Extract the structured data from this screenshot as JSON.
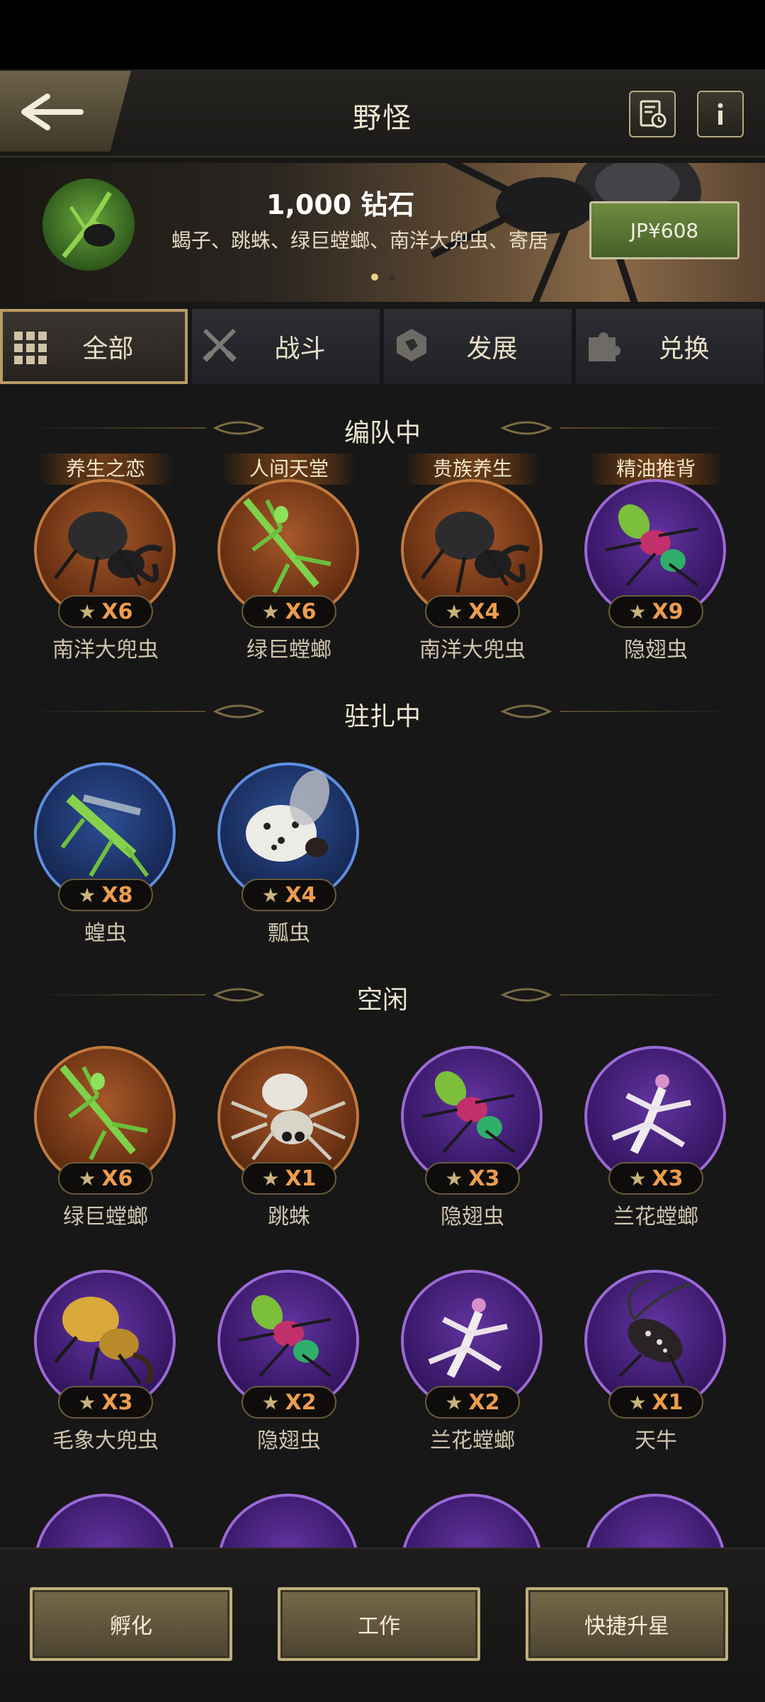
{
  "header": {
    "title": "野怪"
  },
  "banner": {
    "title": "1,000 钻石",
    "description": "蝎子、跳蛛、绿巨螳螂、南洋大兜虫、寄居",
    "price": "JP¥608"
  },
  "tabs": [
    {
      "label": "全部",
      "active": true
    },
    {
      "label": "战斗",
      "active": false
    },
    {
      "label": "发展",
      "active": false
    },
    {
      "label": "兑换",
      "active": false
    }
  ],
  "sections": {
    "formation": {
      "title": "编队中",
      "items": [
        {
          "tag": "养生之恋",
          "stars": "X6",
          "name": "南洋大兜虫",
          "rarity": "orange"
        },
        {
          "tag": "人间天堂",
          "stars": "X6",
          "name": "绿巨螳螂",
          "rarity": "orange"
        },
        {
          "tag": "贵族养生",
          "stars": "X4",
          "name": "南洋大兜虫",
          "rarity": "orange"
        },
        {
          "tag": "精油推背",
          "stars": "X9",
          "name": "隐翅虫",
          "rarity": "purple"
        }
      ]
    },
    "stationed": {
      "title": "驻扎中",
      "items": [
        {
          "stars": "X8",
          "name": "蝗虫",
          "rarity": "blue"
        },
        {
          "stars": "X4",
          "name": "瓢虫",
          "rarity": "blue"
        }
      ]
    },
    "idle": {
      "title": "空闲",
      "items": [
        {
          "stars": "X6",
          "name": "绿巨螳螂",
          "rarity": "orange"
        },
        {
          "stars": "X1",
          "name": "跳蛛",
          "rarity": "orange"
        },
        {
          "stars": "X3",
          "name": "隐翅虫",
          "rarity": "purple"
        },
        {
          "stars": "X3",
          "name": "兰花螳螂",
          "rarity": "purple"
        },
        {
          "stars": "X3",
          "name": "毛象大兜虫",
          "rarity": "purple"
        },
        {
          "stars": "X2",
          "name": "隐翅虫",
          "rarity": "purple"
        },
        {
          "stars": "X2",
          "name": "兰花螳螂",
          "rarity": "purple"
        },
        {
          "stars": "X1",
          "name": "天牛",
          "rarity": "purple"
        }
      ]
    }
  },
  "footer": {
    "hatch": "孵化",
    "work": "工作",
    "quick_star": "快捷升星"
  },
  "colors": {
    "accent_gold": "#b79c63",
    "star_count": "#ee9c4e",
    "price_green": "#5b7a35"
  }
}
